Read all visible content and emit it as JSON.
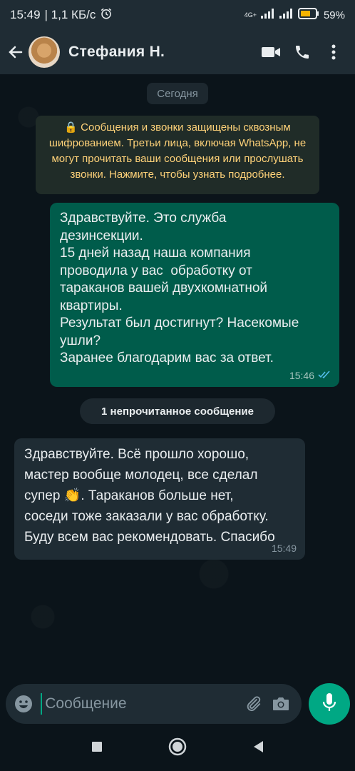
{
  "status_bar": {
    "time": "15:49",
    "speed": "| 1,1 КБ/с",
    "network": "4G+",
    "battery": "59%"
  },
  "header": {
    "contact_name": "Стефания  Н.",
    "icons": [
      "back-arrow-icon",
      "video-call-icon",
      "phone-icon",
      "more-vert-icon"
    ]
  },
  "chat": {
    "date_chip": "Сегодня",
    "encryption_notice": "🔒 Сообщения и звонки защищены сквозным шифрованием. Третьи лица, включая WhatsApp, не могут прочитать ваши сообщения или прослушать звонки. Нажмите, чтобы узнать подробнее.",
    "outgoing": {
      "text": "Здравствуйте. Это служба\nдезинсекции.\n15 дней назад наша компания\nпроводила у вас  обработку от\nтараканов вашей двухкомнатной\nквартиры.\nРезультат был достигнут? Насекомые\nушли?\nЗаранее благодарим вас за ответ.",
      "time": "15:46",
      "status": "read"
    },
    "unread_label": "1 непрочитанное сообщение",
    "incoming": {
      "text": "Здравствуйте. Всё прошло хорошо,\nмастер вообще молодец, все сделал\nсупер 👏. Тараканов больше нет,\nсоседи тоже заказали у вас обработку.\nБуду всем вас рекомендовать. Спасибо",
      "time": "15:49"
    }
  },
  "input": {
    "placeholder": "Сообщение",
    "value": ""
  },
  "colors": {
    "accent": "#00a884",
    "outgoing_bubble": "#005c4b",
    "incoming_bubble": "#1f2c34",
    "background": "#0b141a",
    "notice_text": "#ffd279"
  }
}
